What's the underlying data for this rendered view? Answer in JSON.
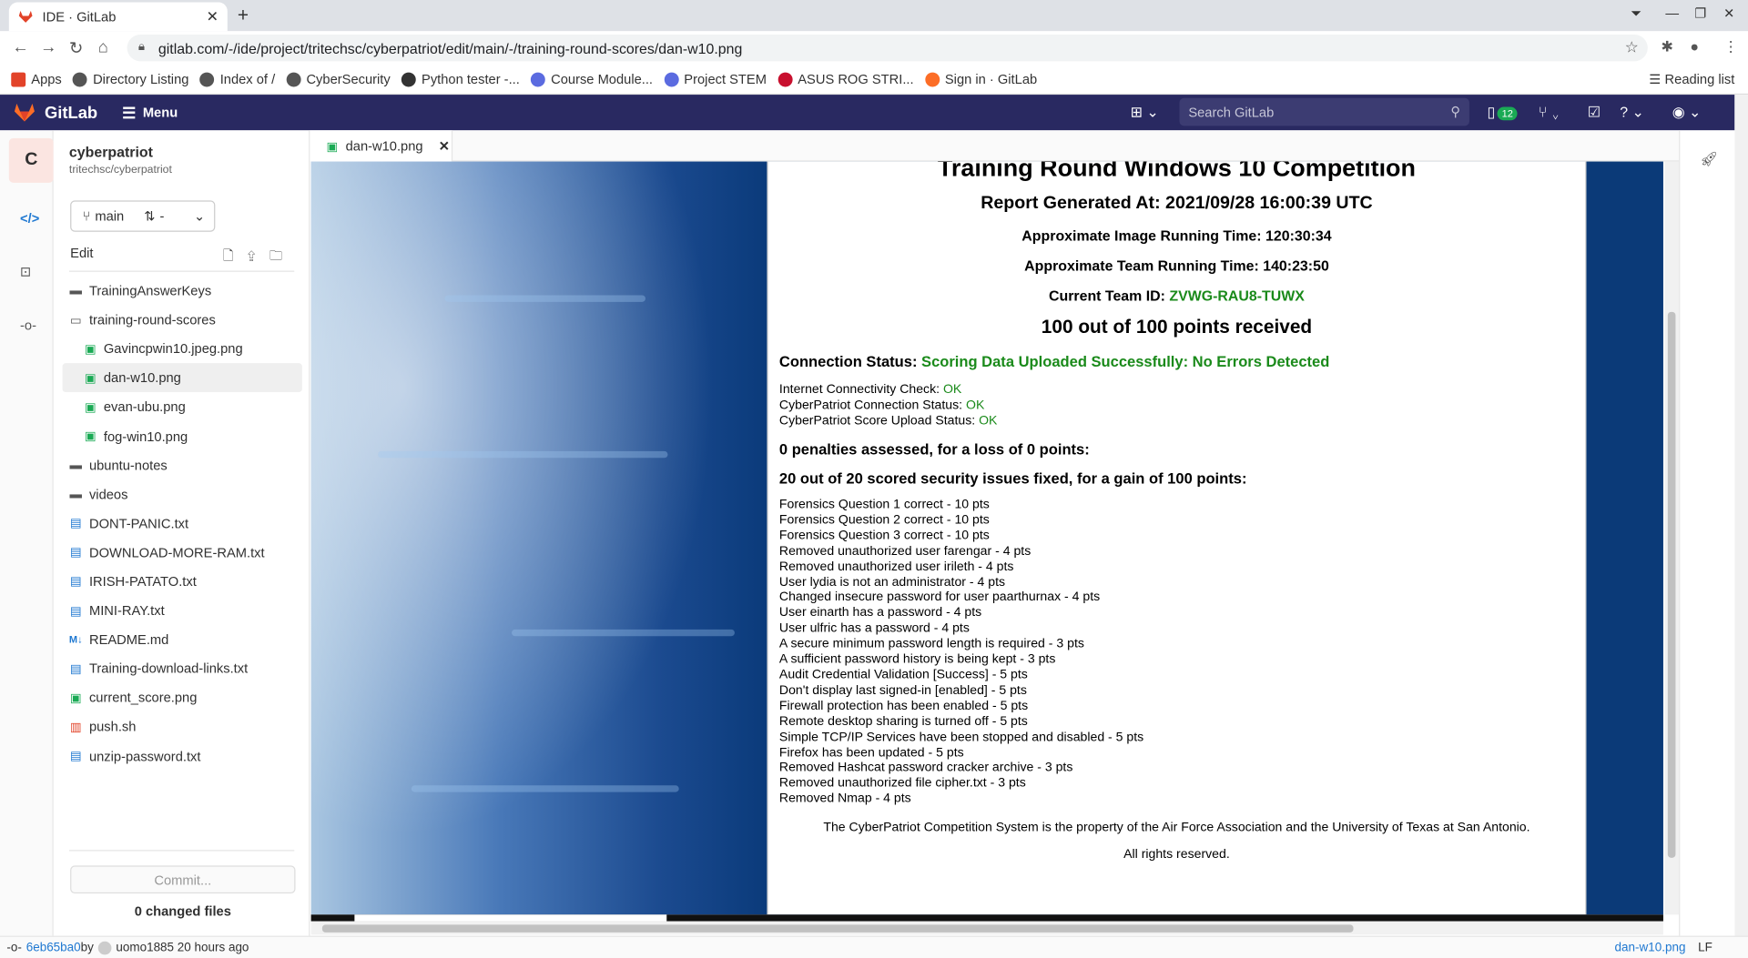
{
  "browser": {
    "tab_title": "IDE · GitLab",
    "tab_close": "✕",
    "new_tab": "+",
    "url": "gitlab.com/-/ide/project/tritechsc/cyberpatriot/edit/main/-/training-round-scores/dan-w10.png",
    "bookmarks": [
      "Apps",
      "Directory Listing",
      "Index of /",
      "CyberSecurity",
      "Python tester -...",
      "Course Module...",
      "Project STEM",
      "ASUS ROG STRI...",
      "Sign in · GitLab"
    ],
    "reading_list": "Reading list"
  },
  "gitlab": {
    "logo_text": "GitLab",
    "menu_label": "Menu",
    "search_placeholder": "Search GitLab",
    "todo_badge": "12"
  },
  "project": {
    "avatar_letter": "C",
    "name": "cyberpatriot",
    "path": "tritechsc/cyberpatriot",
    "branch": "main",
    "mr_label": "-",
    "edit_label": "Edit",
    "tree": [
      {
        "name": "TrainingAnswerKeys",
        "type": "folder",
        "depth": 0
      },
      {
        "name": "training-round-scores",
        "type": "folder-open",
        "depth": 0
      },
      {
        "name": "Gavincpwin10.jpeg.png",
        "type": "img",
        "depth": 1
      },
      {
        "name": "dan-w10.png",
        "type": "img",
        "depth": 1,
        "selected": true
      },
      {
        "name": "evan-ubu.png",
        "type": "img",
        "depth": 1
      },
      {
        "name": "fog-win10.png",
        "type": "img",
        "depth": 1
      },
      {
        "name": "ubuntu-notes",
        "type": "folder",
        "depth": 0
      },
      {
        "name": "videos",
        "type": "folder",
        "depth": 0
      },
      {
        "name": "DONT-PANIC.txt",
        "type": "txt",
        "depth": 0
      },
      {
        "name": "DOWNLOAD-MORE-RAM.txt",
        "type": "txt",
        "depth": 0
      },
      {
        "name": "IRISH-PATATO.txt",
        "type": "txt",
        "depth": 0
      },
      {
        "name": "MINI-RAY.txt",
        "type": "txt",
        "depth": 0
      },
      {
        "name": "README.md",
        "type": "md",
        "depth": 0
      },
      {
        "name": "Training-download-links.txt",
        "type": "txt",
        "depth": 0
      },
      {
        "name": "current_score.png",
        "type": "img",
        "depth": 0
      },
      {
        "name": "push.sh",
        "type": "sh",
        "depth": 0
      },
      {
        "name": "unzip-password.txt",
        "type": "txt",
        "depth": 0
      }
    ],
    "commit_button": "Commit...",
    "changed_files": "0 changed files"
  },
  "editor": {
    "open_tab": "dan-w10.png",
    "tab_close": "✕"
  },
  "report": {
    "title": "Training Round Windows 10 Competition",
    "generated": "Report Generated At: 2021/09/28 16:00:39 UTC",
    "image_time": "Approximate Image Running Time: 120:30:34",
    "team_time": "Approximate Team Running Time: 140:23:50",
    "team_id_label": "Current Team ID: ",
    "team_id": "ZVWG-RAU8-TUWX",
    "points": "100 out of 100 points received",
    "conn_label": "Connection Status: ",
    "conn_value": "Scoring Data Uploaded Successfully: No Errors Detected",
    "checks": [
      {
        "label": "Internet Connectivity Check: ",
        "value": "OK"
      },
      {
        "label": "CyberPatriot Connection Status: ",
        "value": "OK"
      },
      {
        "label": "CyberPatriot Score Upload Status: ",
        "value": "OK"
      }
    ],
    "penalties": "0 penalties assessed, for a loss of 0 points:",
    "fixed": "20 out of 20 scored security issues fixed, for a gain of 100 points:",
    "items": [
      "Forensics Question 1 correct - 10 pts",
      "Forensics Question 2 correct - 10 pts",
      "Forensics Question 3 correct - 10 pts",
      "Removed unauthorized user farengar - 4 pts",
      "Removed unauthorized user irileth - 4 pts",
      "User lydia is not an administrator - 4 pts",
      "Changed insecure password for user paarthurnax - 4 pts",
      "User einarth has a password - 4 pts",
      "User ulfric has a password - 4 pts",
      "A secure minimum password length is required - 3 pts",
      "A sufficient password history is being kept - 3 pts",
      "Audit Credential Validation [Success] - 5 pts",
      "Don't display last signed-in [enabled] - 5 pts",
      "Firewall protection has been enabled - 5 pts",
      "Remote desktop sharing is turned off - 5 pts",
      "Simple TCP/IP Services have been stopped and disabled - 5 pts",
      "Firefox has been updated - 5 pts",
      "Removed Hashcat password cracker archive - 3 pts",
      "Removed unauthorized file cipher.txt - 3 pts",
      "Removed Nmap - 4 pts"
    ],
    "footer": "The CyberPatriot Competition System is the property of the Air Force Association and the University of Texas at San Antonio.",
    "rights": "All rights reserved."
  },
  "status": {
    "commit_sha": "6eb65ba0",
    "by": " by ",
    "author_time": "uomo1885 20 hours ago",
    "filename": "dan-w10.png",
    "eol": "LF"
  },
  "colors": {
    "gitlab_header": "#292961",
    "ok_green": "#1a8a1a",
    "link_blue": "#1f78d1"
  }
}
